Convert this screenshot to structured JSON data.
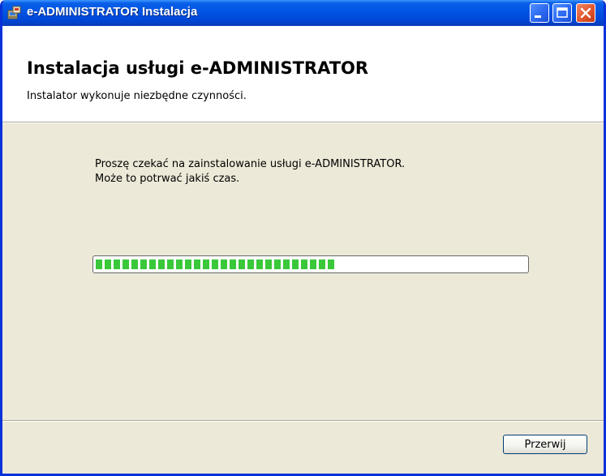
{
  "window": {
    "title": "e-ADMINISTRATOR Instalacja",
    "title_bar_color": "#0054e3",
    "close_button_color": "#e2562d",
    "icon": "installer-icon"
  },
  "header": {
    "title": "Instalacja usługi e-ADMINISTRATOR",
    "subtitle": "Instalator wykonuje niezbędne czynności."
  },
  "body": {
    "line1": "Proszę czekać na zainstalowanie usługi e-ADMINISTRATOR.",
    "line2": "Może to potrwać jakiś czas."
  },
  "progress": {
    "value": 0.58,
    "fill_color": "#39c839"
  },
  "buttons": {
    "cancel_label": "Przerwij"
  }
}
